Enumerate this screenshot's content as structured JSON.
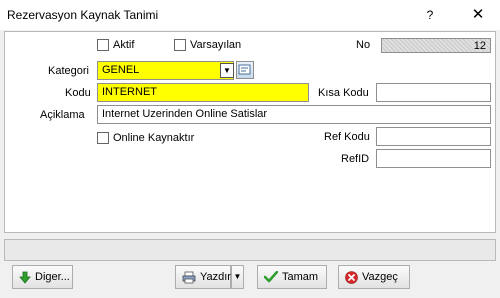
{
  "window": {
    "title": "Rezervasyon Kaynak Tanimi",
    "help_glyph": "?",
    "close_glyph": "✕"
  },
  "form": {
    "aktif": {
      "label": "Aktif",
      "checked": false
    },
    "varsayilan": {
      "label": "Varsayılan",
      "checked": false
    },
    "no": {
      "label": "No",
      "value": "12"
    },
    "kategori": {
      "label": "Kategori",
      "value": "GENEL",
      "arrow": "▼"
    },
    "kodu": {
      "label": "Kodu",
      "value": "INTERNET"
    },
    "kisa_kodu": {
      "label": "Kısa Kodu",
      "value": ""
    },
    "aciklama": {
      "label": "Açiklama",
      "value": "Internet Uzerinden Online Satislar"
    },
    "online": {
      "label": "Online Kaynaktır",
      "checked": false
    },
    "ref_kodu": {
      "label": "Ref Kodu",
      "value": ""
    },
    "ref_id": {
      "label": "RefID",
      "value": ""
    }
  },
  "buttons": {
    "diger": "Diger...",
    "yazdir": "Yazdır",
    "yazdir_arrow": "▼",
    "tamam": "Tamam",
    "vazgec": "Vazgeç"
  },
  "colors": {
    "required_field": "#ffff00"
  }
}
